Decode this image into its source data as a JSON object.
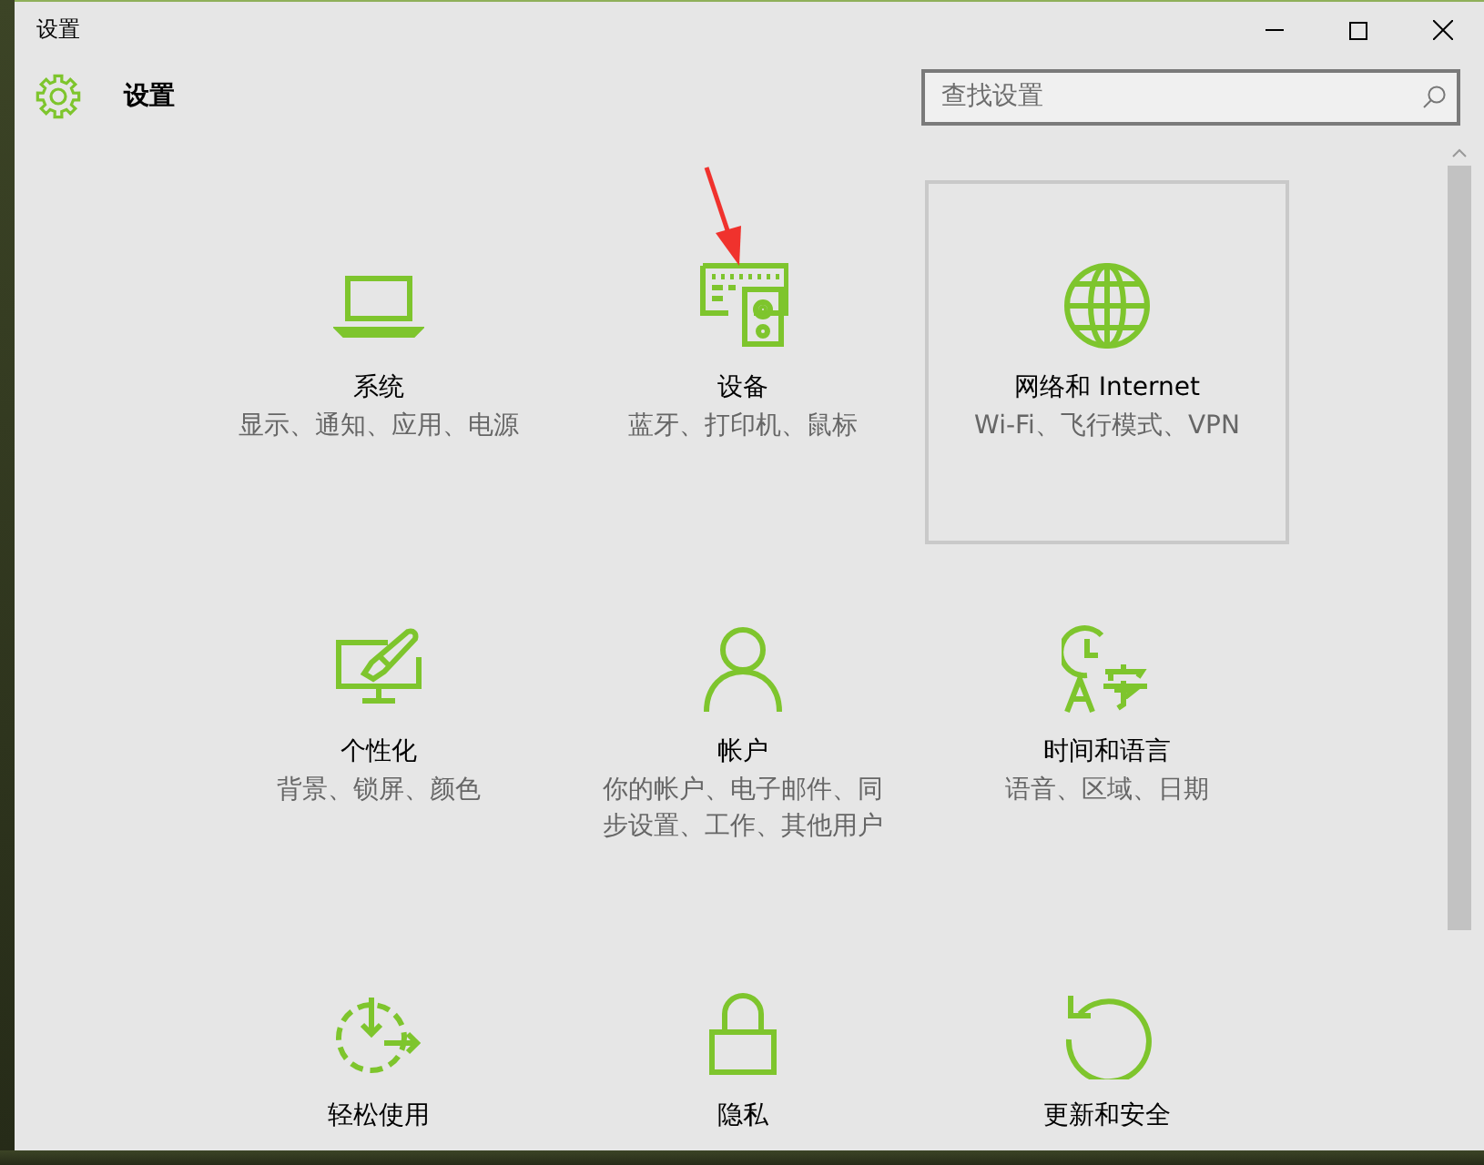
{
  "window": {
    "title": "设置"
  },
  "header": {
    "title": "设置"
  },
  "search": {
    "placeholder": "查找设置"
  },
  "tiles": [
    {
      "kind": "system",
      "title": "系统",
      "subtitle": "显示、通知、应用、电源",
      "highlighted": false
    },
    {
      "kind": "devices",
      "title": "设备",
      "subtitle": "蓝牙、打印机、鼠标",
      "highlighted": false
    },
    {
      "kind": "network",
      "title": "网络和 Internet",
      "subtitle": "Wi-Fi、飞行模式、VPN",
      "highlighted": true
    },
    {
      "kind": "personalization",
      "title": "个性化",
      "subtitle": "背景、锁屏、颜色",
      "highlighted": false
    },
    {
      "kind": "accounts",
      "title": "帐户",
      "subtitle": "你的帐户、电子邮件、同步设置、工作、其他用户",
      "highlighted": false
    },
    {
      "kind": "time",
      "title": "时间和语言",
      "subtitle": "语音、区域、日期",
      "highlighted": false
    },
    {
      "kind": "ease",
      "title": "轻松使用",
      "highlighted": false
    },
    {
      "kind": "privacy",
      "title": "隐私",
      "highlighted": false
    },
    {
      "kind": "update",
      "title": "更新和安全",
      "highlighted": false
    }
  ]
}
